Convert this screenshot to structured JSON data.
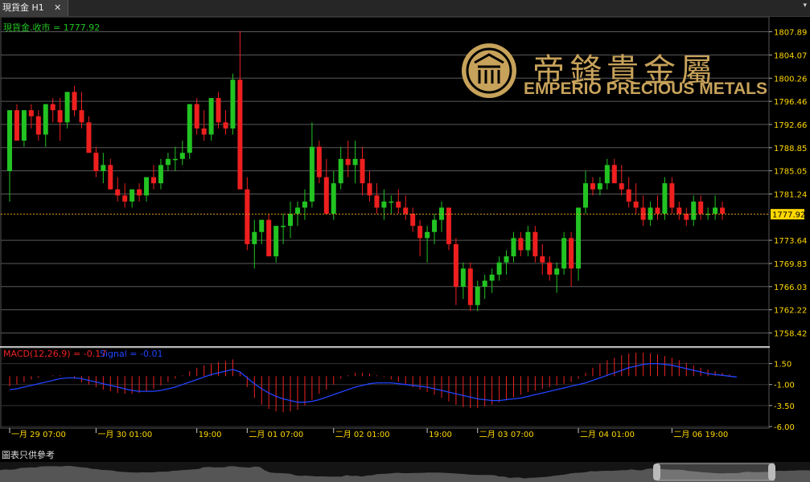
{
  "window": {
    "tab_label": "現貨金 H1",
    "tab_close": "✕",
    "menu_arrow": "▾"
  },
  "price_panel": {
    "label": "現貨金.收市 = 1777.92",
    "current_price": "1777.92",
    "price_axis": [
      "1807.89",
      "1804.07",
      "1800.26",
      "1796.46",
      "1792.66",
      "1788.85",
      "1785.05",
      "1781.24",
      "1777.92",
      "1773.64",
      "1769.83",
      "1766.03",
      "1762.22",
      "1758.42"
    ]
  },
  "logo": {
    "chinese": "帝鋒貴金屬",
    "english": "EMPERIO PRECIOUS METALS"
  },
  "macd_panel": {
    "label": "MACD(12,26,9) = -0.17",
    "signal_label": "Signal = -0.01",
    "axis": [
      "1.50",
      "-1.00",
      "-3.50",
      "-6.00"
    ]
  },
  "time_axis": [
    "一月 29 07:00",
    "一月 30 01:00",
    "19:00",
    "二月 01 07:00",
    "二月 02 01:00",
    "19:00",
    "二月 03 07:00",
    "二月 04 01:00",
    "二月 06 19:00"
  ],
  "footer": {
    "disclaimer": "圖表只供參考"
  },
  "colors": {
    "up": "#22c322",
    "down": "#ee1f1f",
    "grid": "#5a5a5a",
    "axis_text": "#ffd800",
    "price_line": "#e8a020",
    "current_price_bg": "#ffd800",
    "signal_line": "#2244ff",
    "macd_hist": "#ee2222",
    "logo_gold": "#c7a25a"
  },
  "chart_data": {
    "type": "candlestick",
    "symbol": "現貨金",
    "timeframe": "H1",
    "ylim": [
      1756.5,
      1809.8
    ],
    "last_close": 1777.92,
    "ohlc": [
      [
        1785,
        1795,
        1780,
        1795
      ],
      [
        1795,
        1796,
        1790,
        1790
      ],
      [
        1790,
        1795,
        1789,
        1795
      ],
      [
        1795,
        1796,
        1792,
        1794
      ],
      [
        1794,
        1795,
        1790,
        1791
      ],
      [
        1791,
        1796,
        1789,
        1796
      ],
      [
        1796,
        1797,
        1793,
        1795
      ],
      [
        1795,
        1797,
        1790,
        1793
      ],
      [
        1793,
        1798,
        1792,
        1798
      ],
      [
        1798,
        1799,
        1794,
        1795
      ],
      [
        1795,
        1798,
        1792,
        1793
      ],
      [
        1793,
        1794,
        1788,
        1788
      ],
      [
        1788,
        1789,
        1784,
        1785
      ],
      [
        1785,
        1788,
        1783,
        1786
      ],
      [
        1786,
        1787,
        1782,
        1782
      ],
      [
        1782,
        1784,
        1780,
        1781
      ],
      [
        1781,
        1783,
        1779,
        1780
      ],
      [
        1780,
        1782,
        1779,
        1782
      ],
      [
        1782,
        1783,
        1780,
        1781
      ],
      [
        1781,
        1784,
        1780,
        1784
      ],
      [
        1784,
        1786,
        1782,
        1783
      ],
      [
        1783,
        1787,
        1782,
        1786
      ],
      [
        1786,
        1788,
        1785,
        1787
      ],
      [
        1787,
        1789,
        1785,
        1787
      ],
      [
        1787,
        1790,
        1786,
        1788
      ],
      [
        1788,
        1796,
        1787,
        1796
      ],
      [
        1796,
        1797,
        1791,
        1792
      ],
      [
        1792,
        1795,
        1790,
        1791
      ],
      [
        1791,
        1797,
        1790,
        1797
      ],
      [
        1797,
        1798,
        1792,
        1793
      ],
      [
        1793,
        1795,
        1791,
        1792
      ],
      [
        1792,
        1801,
        1791,
        1800
      ],
      [
        1800,
        1808,
        1796,
        1782
      ],
      [
        1782,
        1784,
        1772,
        1773
      ],
      [
        1773,
        1777,
        1769,
        1775
      ],
      [
        1775,
        1777,
        1773,
        1777
      ],
      [
        1777,
        1778,
        1771,
        1771
      ],
      [
        1771,
        1776,
        1770,
        1776
      ],
      [
        1776,
        1778,
        1773,
        1776
      ],
      [
        1776,
        1780,
        1774,
        1778
      ],
      [
        1778,
        1780,
        1776,
        1779
      ],
      [
        1779,
        1782,
        1777,
        1780
      ],
      [
        1780,
        1793,
        1779,
        1789
      ],
      [
        1789,
        1790,
        1783,
        1784
      ],
      [
        1784,
        1787,
        1778,
        1778
      ],
      [
        1778,
        1785,
        1777,
        1783
      ],
      [
        1783,
        1789,
        1782,
        1787
      ],
      [
        1787,
        1790,
        1784,
        1786
      ],
      [
        1786,
        1790,
        1783,
        1787
      ],
      [
        1787,
        1789,
        1781,
        1783
      ],
      [
        1783,
        1785,
        1780,
        1781
      ],
      [
        1781,
        1783,
        1778,
        1779
      ],
      [
        1779,
        1782,
        1777,
        1780
      ],
      [
        1780,
        1781,
        1778,
        1780
      ],
      [
        1780,
        1782,
        1778,
        1779
      ],
      [
        1779,
        1781,
        1777,
        1778
      ],
      [
        1778,
        1779,
        1775,
        1776
      ],
      [
        1776,
        1777,
        1771,
        1774
      ],
      [
        1774,
        1776,
        1770,
        1775
      ],
      [
        1775,
        1778,
        1773,
        1777
      ],
      [
        1777,
        1780,
        1775,
        1779
      ],
      [
        1779,
        1779,
        1772,
        1773
      ],
      [
        1773,
        1774,
        1763,
        1766
      ],
      [
        1766,
        1770,
        1764,
        1769
      ],
      [
        1769,
        1770,
        1762,
        1763
      ],
      [
        1763,
        1767,
        1762,
        1766
      ],
      [
        1766,
        1768,
        1764,
        1767
      ],
      [
        1767,
        1769,
        1765,
        1768
      ],
      [
        1768,
        1771,
        1767,
        1770
      ],
      [
        1770,
        1772,
        1768,
        1771
      ],
      [
        1771,
        1775,
        1770,
        1774
      ],
      [
        1774,
        1775,
        1771,
        1772
      ],
      [
        1772,
        1776,
        1771,
        1775
      ],
      [
        1775,
        1776,
        1770,
        1771
      ],
      [
        1771,
        1773,
        1768,
        1770
      ],
      [
        1770,
        1771,
        1767,
        1768
      ],
      [
        1768,
        1770,
        1765,
        1769
      ],
      [
        1769,
        1775,
        1768,
        1774
      ],
      [
        1774,
        1775,
        1766,
        1769
      ],
      [
        1769,
        1779,
        1767,
        1779
      ],
      [
        1779,
        1785,
        1778,
        1783
      ],
      [
        1783,
        1784,
        1781,
        1782
      ],
      [
        1782,
        1784,
        1781,
        1783
      ],
      [
        1783,
        1787,
        1782,
        1786
      ],
      [
        1786,
        1787,
        1783,
        1783
      ],
      [
        1783,
        1786,
        1781,
        1782
      ],
      [
        1782,
        1784,
        1779,
        1780
      ],
      [
        1780,
        1783,
        1778,
        1779
      ],
      [
        1779,
        1781,
        1776,
        1777
      ],
      [
        1777,
        1780,
        1776,
        1779
      ],
      [
        1779,
        1781,
        1777,
        1778
      ],
      [
        1778,
        1784,
        1777,
        1783
      ],
      [
        1783,
        1784,
        1778,
        1779
      ],
      [
        1779,
        1780,
        1777,
        1778
      ],
      [
        1778,
        1779,
        1776,
        1777
      ],
      [
        1777,
        1781,
        1776,
        1780
      ],
      [
        1780,
        1781,
        1777,
        1778
      ],
      [
        1778,
        1779,
        1777,
        1778
      ],
      [
        1778,
        1781,
        1777,
        1779
      ],
      [
        1779,
        1780,
        1777,
        1778
      ]
    ],
    "macd": {
      "hist": [
        -1.2,
        -1.0,
        -0.7,
        -0.4,
        -0.2,
        0.0,
        0.1,
        0.1,
        0.0,
        -0.3,
        -0.7,
        -1.0,
        -1.3,
        -1.6,
        -1.8,
        -2.0,
        -2.1,
        -2.1,
        -2.0,
        -1.8,
        -1.5,
        -1.1,
        -0.7,
        -0.3,
        0.1,
        0.6,
        1.0,
        1.3,
        1.5,
        1.7,
        1.8,
        2.0,
        0.5,
        -1.3,
        -2.6,
        -3.4,
        -3.9,
        -4.2,
        -4.3,
        -4.2,
        -4.0,
        -3.5,
        -2.8,
        -2.1,
        -1.6,
        -1.0,
        -0.3,
        0.1,
        0.4,
        0.4,
        0.3,
        0.1,
        -0.1,
        -0.4,
        -0.7,
        -1.0,
        -1.3,
        -1.6,
        -1.9,
        -2.2,
        -2.6,
        -3.0,
        -3.4,
        -3.7,
        -3.8,
        -3.8,
        -3.6,
        -3.4,
        -3.1,
        -2.8,
        -2.5,
        -2.2,
        -1.9,
        -1.7,
        -1.5,
        -1.3,
        -1.1,
        -0.9,
        -0.7,
        -0.3,
        0.4,
        1.0,
        1.5,
        1.9,
        2.2,
        2.5,
        2.7,
        2.8,
        2.8,
        2.7,
        2.6,
        2.4,
        2.2,
        1.9,
        1.6,
        1.3,
        1.0,
        0.8,
        0.6,
        0.4,
        0.2,
        0.0
      ],
      "signal": [
        -1.6,
        -1.5,
        -1.3,
        -1.1,
        -0.9,
        -0.7,
        -0.5,
        -0.3,
        -0.2,
        -0.2,
        -0.3,
        -0.5,
        -0.7,
        -0.9,
        -1.1,
        -1.3,
        -1.5,
        -1.7,
        -1.8,
        -1.8,
        -1.8,
        -1.7,
        -1.5,
        -1.3,
        -1.0,
        -0.7,
        -0.4,
        -0.1,
        0.2,
        0.4,
        0.6,
        0.8,
        0.5,
        -0.2,
        -0.9,
        -1.5,
        -2.0,
        -2.4,
        -2.7,
        -2.9,
        -3.1,
        -3.1,
        -3.0,
        -2.8,
        -2.5,
        -2.2,
        -1.9,
        -1.6,
        -1.3,
        -1.1,
        -0.9,
        -0.8,
        -0.8,
        -0.8,
        -0.9,
        -1.0,
        -1.1,
        -1.2,
        -1.3,
        -1.5,
        -1.7,
        -1.9,
        -2.1,
        -2.3,
        -2.5,
        -2.7,
        -2.8,
        -2.9,
        -2.9,
        -2.8,
        -2.7,
        -2.6,
        -2.4,
        -2.2,
        -2.0,
        -1.8,
        -1.6,
        -1.4,
        -1.2,
        -1.0,
        -0.8,
        -0.5,
        -0.2,
        0.1,
        0.4,
        0.7,
        1.0,
        1.2,
        1.4,
        1.5,
        1.5,
        1.4,
        1.3,
        1.1,
        0.9,
        0.7,
        0.5,
        0.3,
        0.2,
        0.1,
        0.0,
        -0.1
      ],
      "ylim": [
        -6.0,
        2.8
      ]
    }
  }
}
